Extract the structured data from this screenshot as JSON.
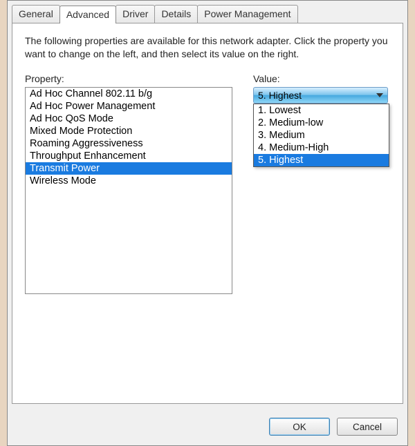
{
  "tabs": {
    "general": "General",
    "advanced": "Advanced",
    "driver": "Driver",
    "details": "Details",
    "power": "Power Management"
  },
  "description": "The following properties are available for this network adapter. Click the property you want to change on the left, and then select its value on the right.",
  "property_label": "Property:",
  "value_label": "Value:",
  "properties": [
    "Ad Hoc Channel 802.11 b/g",
    "Ad Hoc Power Management",
    "Ad Hoc QoS Mode",
    "Mixed Mode Protection",
    "Roaming Aggressiveness",
    "Throughput Enhancement",
    "Transmit Power",
    "Wireless Mode"
  ],
  "selected_property_index": 6,
  "combo_selected": "5. Highest",
  "combo_options": [
    "1. Lowest",
    "2. Medium-low",
    "3. Medium",
    "4. Medium-High",
    "5. Highest"
  ],
  "combo_highlight_index": 4,
  "buttons": {
    "ok": "OK",
    "cancel": "Cancel"
  }
}
